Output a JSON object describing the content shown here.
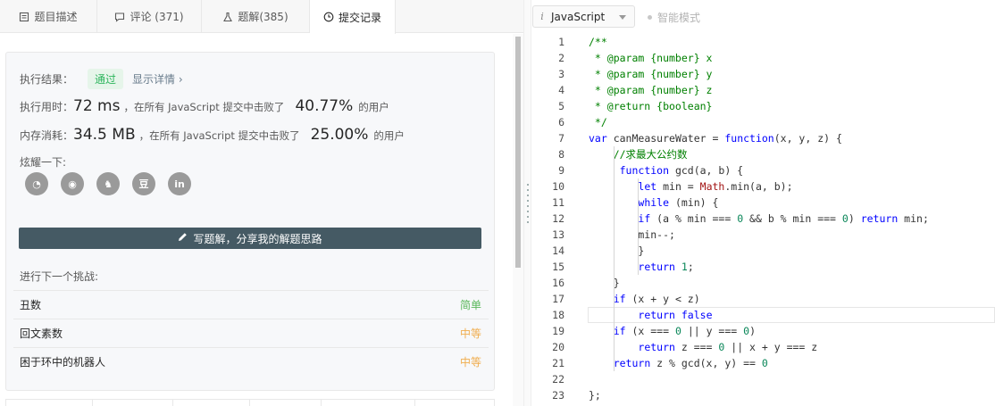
{
  "tabs": [
    {
      "label": "题目描述",
      "icon": "document-icon"
    },
    {
      "label": "评论 (371)",
      "icon": "comment-icon"
    },
    {
      "label": "题解(385)",
      "icon": "flask-icon"
    },
    {
      "label": "提交记录",
      "icon": "clock-icon",
      "active": true
    }
  ],
  "result": {
    "label": "执行结果：",
    "status": "通过",
    "detail": "显示详情 ›",
    "time_label": "执行用时：",
    "time_value": "72 ms",
    "time_text": "，在所有 JavaScript 提交中击败了",
    "time_pct": "40.77%",
    "time_suffix": "的用户",
    "mem_label": "内存消耗：",
    "mem_value": "34.5 MB",
    "mem_text": "，在所有 JavaScript 提交中击败了",
    "mem_pct": "25.00%",
    "mem_suffix": "的用户"
  },
  "share": {
    "label": "炫耀一下:",
    "buttons": [
      {
        "name": "wechat-icon",
        "glyph": "◔"
      },
      {
        "name": "weibo-icon",
        "glyph": "◉"
      },
      {
        "name": "qq-icon",
        "glyph": "♞"
      },
      {
        "name": "douban-icon",
        "glyph": "豆"
      },
      {
        "name": "linkedin-icon",
        "glyph": "in"
      }
    ]
  },
  "write_button": "写题解，分享我的解题思路",
  "next": {
    "label": "进行下一个挑战:",
    "problems": [
      {
        "title": "丑数",
        "difficulty": "简单",
        "level": "easy"
      },
      {
        "title": "回文素数",
        "difficulty": "中等",
        "level": "mid"
      },
      {
        "title": "困于环中的机器人",
        "difficulty": "中等",
        "level": "mid"
      }
    ]
  },
  "editor": {
    "language": "JavaScript",
    "lang_icon": "i",
    "smart_mode": "智能模式",
    "active_line": 18,
    "lines": [
      [
        [
          "/**",
          "com"
        ]
      ],
      [
        [
          " * @param {number} x",
          "com"
        ]
      ],
      [
        [
          " * @param {number} y",
          "com"
        ]
      ],
      [
        [
          " * @param {number} z",
          "com"
        ]
      ],
      [
        [
          " * @return {boolean}",
          "com"
        ]
      ],
      [
        [
          " */",
          "com"
        ]
      ],
      [
        [
          "var",
          "kw"
        ],
        [
          " canMeasureWater = ",
          ""
        ],
        [
          "function",
          "kw"
        ],
        [
          "(x, y, z) {",
          ""
        ]
      ],
      [
        [
          "    ",
          ""
        ],
        [
          "//求最大公约数",
          "com"
        ]
      ],
      [
        [
          "     ",
          ""
        ],
        [
          "function",
          "kw"
        ],
        [
          " gcd(a, b) {",
          ""
        ]
      ],
      [
        [
          "        ",
          ""
        ],
        [
          "let",
          "kw"
        ],
        [
          " min = ",
          ""
        ],
        [
          "Math",
          "cls"
        ],
        [
          ".min(a, b);",
          ""
        ]
      ],
      [
        [
          "        ",
          ""
        ],
        [
          "while",
          "kw"
        ],
        [
          " (min) {",
          ""
        ]
      ],
      [
        [
          "        ",
          ""
        ],
        [
          "if",
          "kw"
        ],
        [
          " (a % min === ",
          ""
        ],
        [
          "0",
          "num"
        ],
        [
          " && b % min === ",
          ""
        ],
        [
          "0",
          "num"
        ],
        [
          ") ",
          ""
        ],
        [
          "return",
          "kw"
        ],
        [
          " min;",
          ""
        ]
      ],
      [
        [
          "        min--;",
          ""
        ]
      ],
      [
        [
          "        }",
          ""
        ]
      ],
      [
        [
          "        ",
          ""
        ],
        [
          "return",
          "kw"
        ],
        [
          " ",
          ""
        ],
        [
          "1",
          "num"
        ],
        [
          ";",
          ""
        ]
      ],
      [
        [
          "    }",
          ""
        ]
      ],
      [
        [
          "    ",
          ""
        ],
        [
          "if",
          "kw"
        ],
        [
          " (x + y < z)",
          ""
        ]
      ],
      [
        [
          "        ",
          ""
        ],
        [
          "return",
          "kw"
        ],
        [
          " ",
          ""
        ],
        [
          "false",
          "kw"
        ]
      ],
      [
        [
          "    ",
          ""
        ],
        [
          "if",
          "kw"
        ],
        [
          " (x === ",
          ""
        ],
        [
          "0",
          "num"
        ],
        [
          " || y === ",
          ""
        ],
        [
          "0",
          "num"
        ],
        [
          ")",
          ""
        ]
      ],
      [
        [
          "        ",
          ""
        ],
        [
          "return",
          "kw"
        ],
        [
          " z === ",
          ""
        ],
        [
          "0",
          "num"
        ],
        [
          " || x + y === z",
          ""
        ]
      ],
      [
        [
          "    ",
          ""
        ],
        [
          "return",
          "kw"
        ],
        [
          " z % gcd(x, y) == ",
          ""
        ],
        [
          "0",
          "num"
        ]
      ],
      [
        [
          "",
          ""
        ]
      ],
      [
        [
          "};",
          ""
        ]
      ]
    ]
  }
}
